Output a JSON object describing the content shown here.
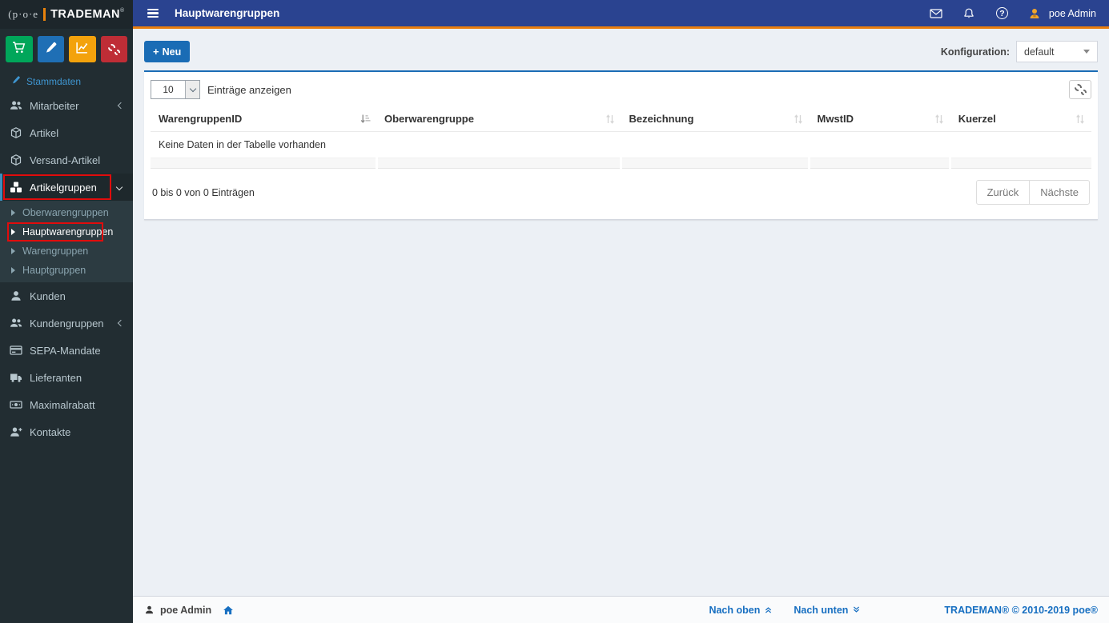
{
  "logo": {
    "prefix": "p·o·e",
    "name": "TRADEMAN",
    "mark": "®"
  },
  "topbar": {
    "title": "Hauptwarengruppen",
    "user_name": "poe Admin",
    "help_glyph": "?",
    "icons": [
      "envelope-icon",
      "bell-icon",
      "help-icon",
      "avatar-icon"
    ]
  },
  "sidebar": {
    "section_label": "Stammdaten",
    "quick_buttons": [
      {
        "name": "cart-icon",
        "color": "#00a65a"
      },
      {
        "name": "pencil-icon",
        "color": "#1f6fb5"
      },
      {
        "name": "chart-icon",
        "color": "#f3a20c"
      },
      {
        "name": "cogs-icon",
        "color": "#bf2d36"
      }
    ],
    "items_top": [
      {
        "label": "Mitarbeiter",
        "icon": "users-icon",
        "arrow": "left"
      },
      {
        "label": "Artikel",
        "icon": "box-icon"
      },
      {
        "label": "Versand-Artikel",
        "icon": "box-icon"
      },
      {
        "label": "Artikelgruppen",
        "icon": "boxes-icon",
        "arrow": "down",
        "active": true,
        "annotated": true
      }
    ],
    "submenu": [
      {
        "label": "Oberwarengruppen"
      },
      {
        "label": "Hauptwarengruppen",
        "active": true,
        "annotated": true
      },
      {
        "label": "Warengruppen"
      },
      {
        "label": "Hauptgruppen"
      }
    ],
    "items_bottom": [
      {
        "label": "Kunden",
        "icon": "user-icon"
      },
      {
        "label": "Kundengruppen",
        "icon": "users-icon",
        "arrow": "left"
      },
      {
        "label": "SEPA-Mandate",
        "icon": "credit-card-icon"
      },
      {
        "label": "Lieferanten",
        "icon": "truck-icon"
      },
      {
        "label": "Maximalrabatt",
        "icon": "money-icon"
      },
      {
        "label": "Kontakte",
        "icon": "user-plus-icon"
      }
    ]
  },
  "toolbar": {
    "new_icon": "+",
    "new_label": "Neu",
    "config_label": "Konfiguration:",
    "config_value": "default"
  },
  "table": {
    "length_value": "10",
    "length_label": "Einträge anzeigen",
    "columns": [
      {
        "label": "WarengruppenID",
        "sort": "sorted-asc"
      },
      {
        "label": "Oberwarengruppe",
        "sort": "none"
      },
      {
        "label": "Bezeichnung",
        "sort": "none"
      },
      {
        "label": "MwstID",
        "sort": "none"
      },
      {
        "label": "Kuerzel",
        "sort": "none"
      }
    ],
    "empty_text": "Keine Daten in der Tabelle vorhanden",
    "info": "0 bis 0 von 0 Einträgen",
    "prev_label": "Zurück",
    "next_label": "Nächste"
  },
  "footer": {
    "user_name": "poe Admin",
    "up_label": "Nach oben",
    "down_label": "Nach unten",
    "copyright": "TRADEMAN® © 2010-2019 poe®"
  },
  "colors": {
    "accent_blue": "#1a6cb5",
    "topbar_blue": "#2a4390",
    "orange_line": "#e87e0f",
    "annotation_red": "#e10c0c",
    "sidebar_bg": "#222d32",
    "submenu_bg": "#2c3b41",
    "btn_green": "#00a65a",
    "btn_blue": "#1f6fb5",
    "btn_yellow": "#f3a20c",
    "btn_red": "#bf2d36"
  }
}
